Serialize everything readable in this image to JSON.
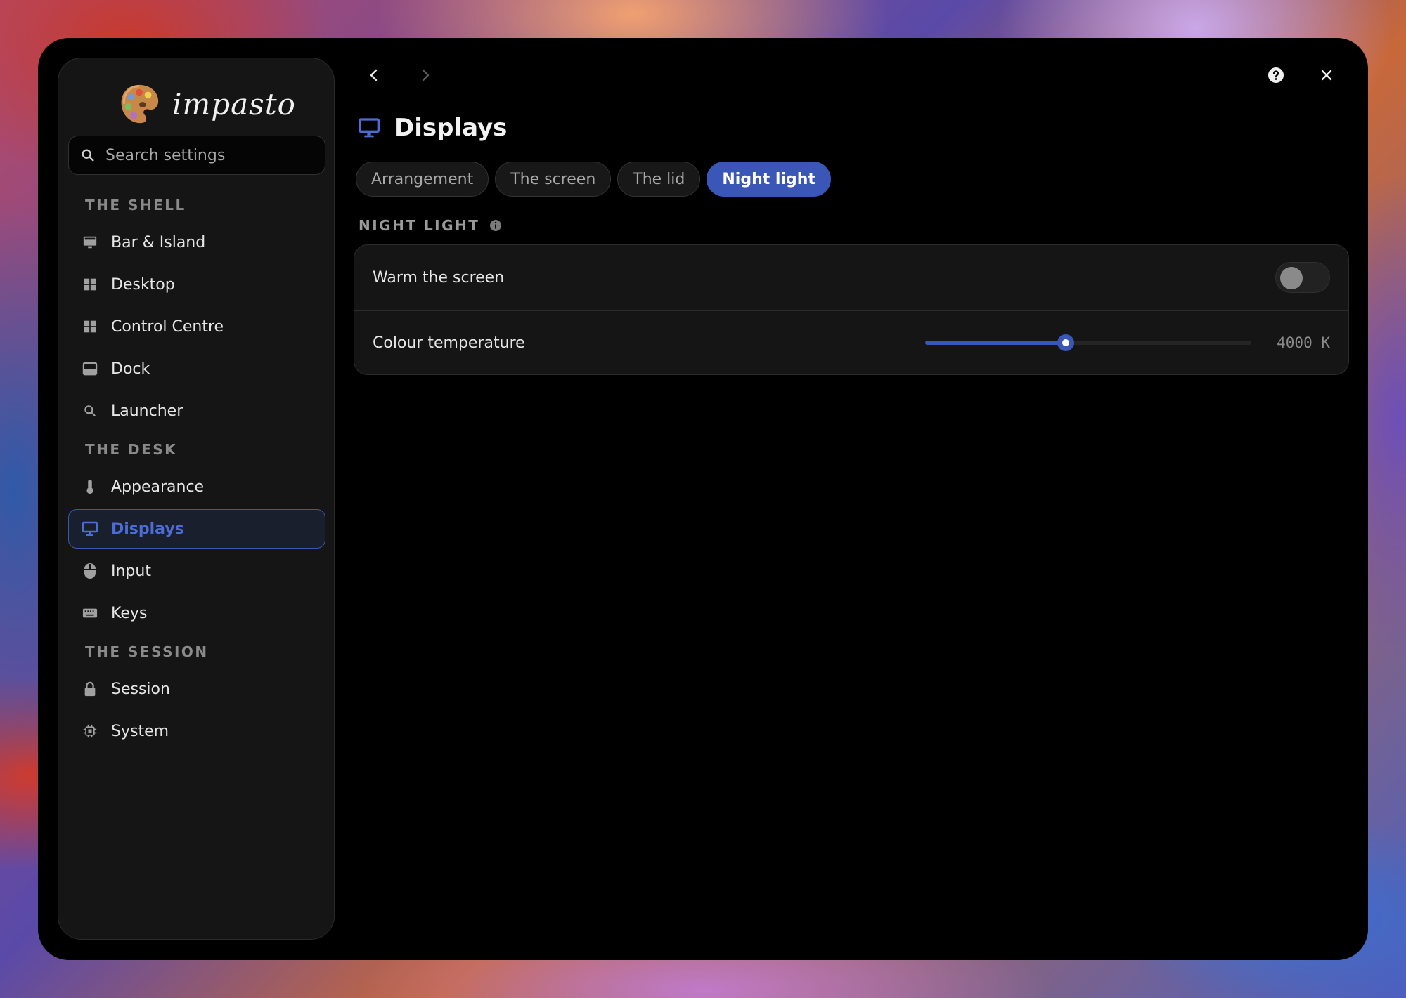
{
  "app": {
    "name": "impasto"
  },
  "search": {
    "placeholder": "Search settings"
  },
  "sidebar": {
    "sections": [
      {
        "label": "THE SHELL"
      },
      {
        "label": "THE DESK"
      },
      {
        "label": "THE SESSION"
      }
    ],
    "items": [
      {
        "label": "Bar & Island",
        "icon": "monitor-bar-icon"
      },
      {
        "label": "Desktop",
        "icon": "grid-icon"
      },
      {
        "label": "Control Centre",
        "icon": "grid-icon"
      },
      {
        "label": "Dock",
        "icon": "dock-icon"
      },
      {
        "label": "Launcher",
        "icon": "search-icon"
      },
      {
        "label": "Appearance",
        "icon": "thermometer-icon"
      },
      {
        "label": "Displays",
        "icon": "monitor-icon",
        "active": true
      },
      {
        "label": "Input",
        "icon": "mouse-icon"
      },
      {
        "label": "Keys",
        "icon": "keyboard-icon"
      },
      {
        "label": "Session",
        "icon": "lock-icon"
      },
      {
        "label": "System",
        "icon": "chip-icon"
      }
    ]
  },
  "page": {
    "title": "Displays",
    "icon": "monitor-icon",
    "tabs": [
      {
        "label": "Arrangement",
        "active": false
      },
      {
        "label": "The screen",
        "active": false
      },
      {
        "label": "The lid",
        "active": false
      },
      {
        "label": "Night light",
        "active": true
      }
    ],
    "group": {
      "label": "NIGHT LIGHT",
      "info_icon": "info-icon",
      "rows": [
        {
          "label": "Warm the screen",
          "control": "toggle",
          "enabled": false
        },
        {
          "label": "Colour temperature",
          "control": "slider",
          "value_text": "4000 K",
          "fraction": 0.43
        }
      ]
    }
  },
  "colors": {
    "accent": "#3a57b7",
    "active_text": "#4d6dd6",
    "window_bg": "#000000",
    "sidebar_bg": "#151515"
  }
}
